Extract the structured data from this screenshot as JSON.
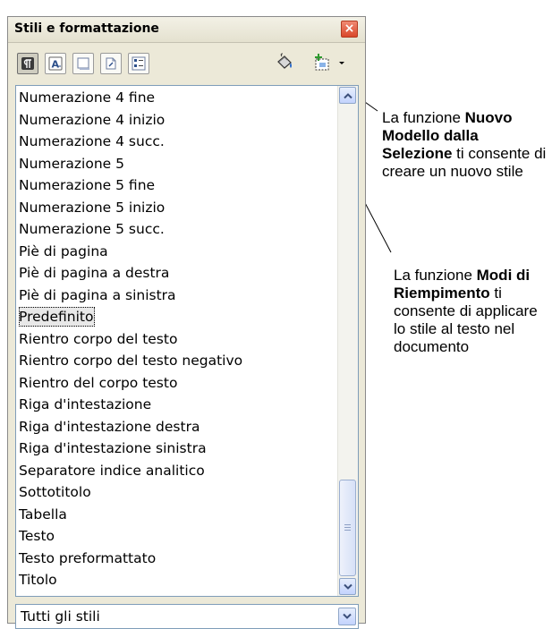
{
  "panel": {
    "title": "Stili e formattazione"
  },
  "toolbar": {
    "buttons": [
      {
        "icon": "paragraph-styles-icon"
      },
      {
        "icon": "character-styles-icon"
      },
      {
        "icon": "frame-styles-icon"
      },
      {
        "icon": "page-styles-icon"
      },
      {
        "icon": "list-styles-icon"
      },
      {
        "icon": "fill-format-mode-icon"
      },
      {
        "icon": "new-style-from-selection-icon"
      }
    ]
  },
  "styles_list": {
    "items": [
      "Numerazione 4 fine",
      "Numerazione 4 inizio",
      "Numerazione 4 succ.",
      "Numerazione 5",
      "Numerazione 5 fine",
      "Numerazione 5 inizio",
      "Numerazione 5 succ.",
      "Piè di pagina",
      "Piè di pagina a destra",
      "Piè di pagina a sinistra",
      "Predefinito",
      "Rientro corpo del testo",
      "Rientro corpo del testo negativo",
      "Rientro del corpo testo",
      "Riga d'intestazione",
      "Riga d'intestazione destra",
      "Riga d'intestazione sinistra",
      "Separatore indice analitico",
      "Sottotitolo",
      "Tabella",
      "Testo",
      "Testo preformattato",
      "Titolo"
    ],
    "selected": "Predefinito"
  },
  "filter": {
    "value": "Tutti gli stili"
  },
  "callouts": {
    "new_style": {
      "pre": "La funzione ",
      "bold": "Nuovo Modello dalla Selezione",
      "post": " ti consente di creare un nuovo stile"
    },
    "fill_mode": {
      "pre": "La funzione ",
      "bold": "Modi di Riempimento",
      "post": " ti consente di applicare lo stile al testo nel documento"
    }
  },
  "colors": {
    "panel_bg": "#ece9d8",
    "list_border": "#7f9db9",
    "close_red": "#d9472b",
    "scroll_blue": "#c3d3fd"
  }
}
